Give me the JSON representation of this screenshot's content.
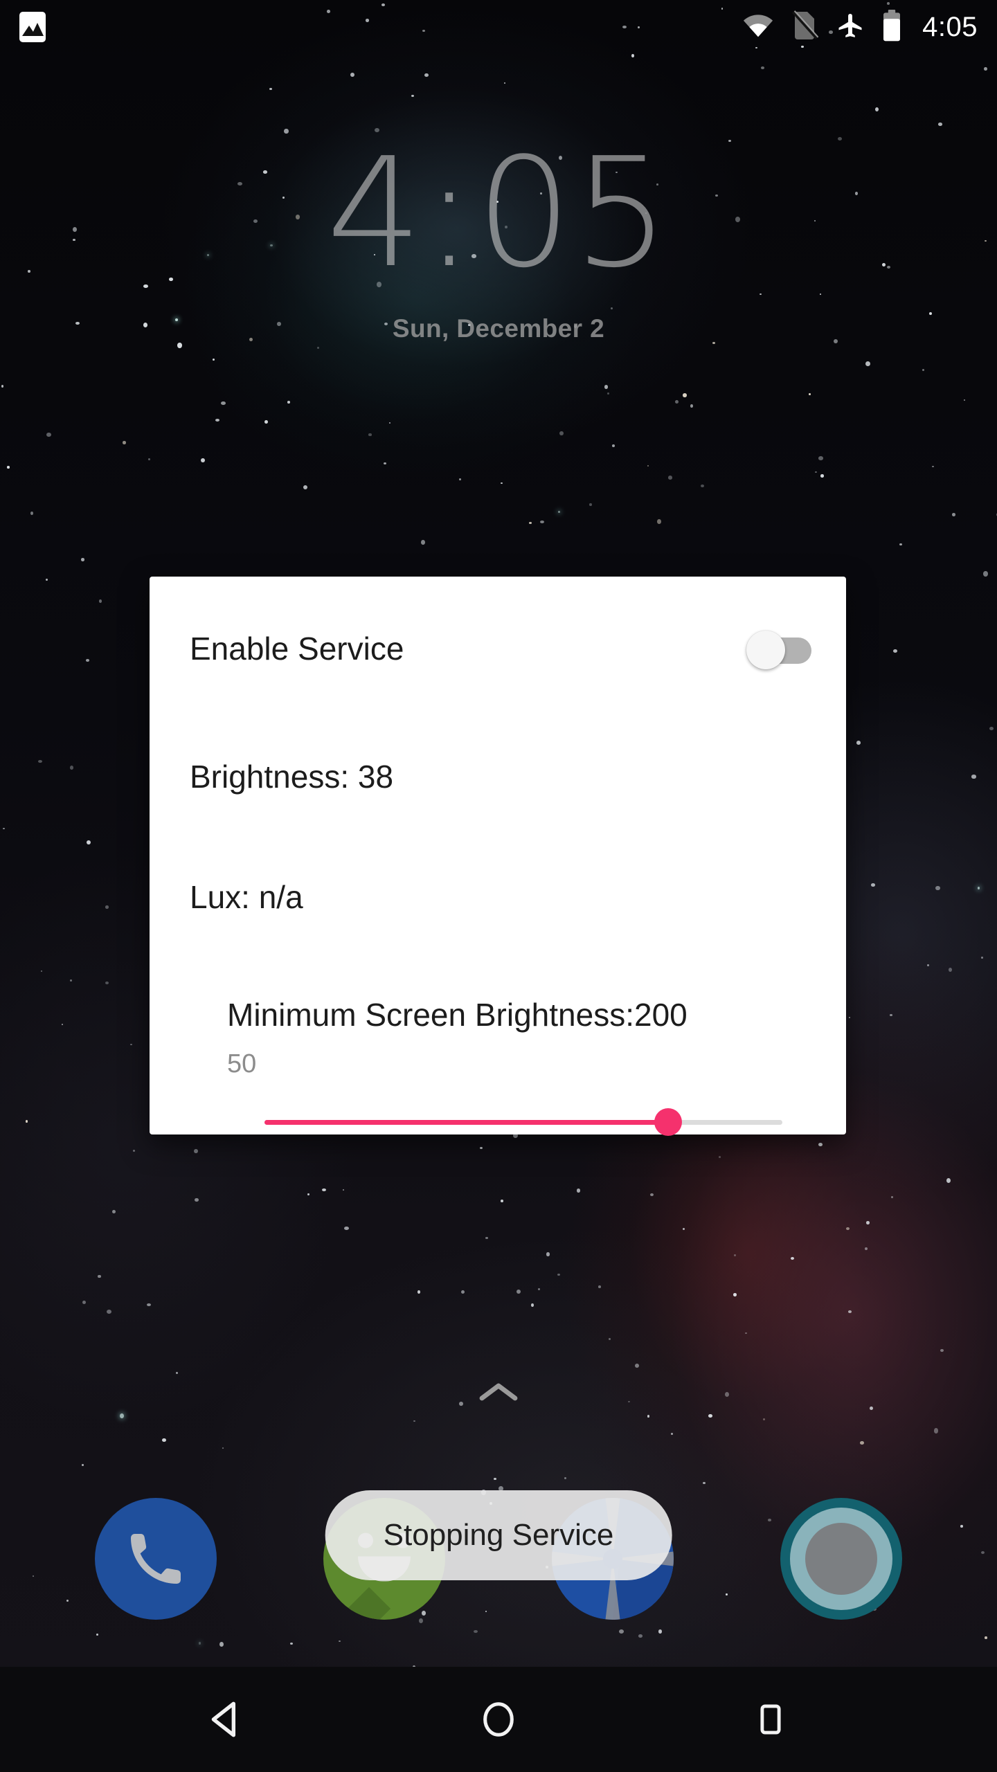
{
  "status_bar": {
    "left_icons": [
      {
        "name": "photo-icon",
        "glyph": "image"
      }
    ],
    "right_icons": [
      {
        "name": "wifi-icon",
        "glyph": "wifi"
      },
      {
        "name": "sim-card-off-icon",
        "glyph": "sim-off"
      },
      {
        "name": "airplane-mode-icon",
        "glyph": "airplane"
      },
      {
        "name": "battery-icon",
        "glyph": "battery"
      }
    ],
    "time": "4:05"
  },
  "lockscreen_widget": {
    "time": "4:05",
    "date": "Sun, December 2"
  },
  "dialog": {
    "enable_service_label": "Enable Service",
    "enable_service_state": "off",
    "brightness_readout": "Brightness: 38",
    "lux_readout": "Lux: n/a",
    "min_brightness_label": "Minimum Screen Brightness:200",
    "min_brightness_value": "50",
    "slider": {
      "percent": 78,
      "accent_color": "#f5316d",
      "track_color": "#dcdcdc"
    }
  },
  "app_drawer": {
    "handle_icon": "chevron-up-icon"
  },
  "dock": {
    "apps": [
      {
        "name": "phone",
        "label": "Phone",
        "color": "#1f4f9c"
      },
      {
        "name": "messages",
        "label": "Messages",
        "color": "#5d8a2e"
      },
      {
        "name": "maps",
        "label": "Maps",
        "color": "#1e4fa3"
      },
      {
        "name": "camera",
        "label": "Camera",
        "color": "#13616e"
      }
    ]
  },
  "toast": {
    "message": "Stopping Service"
  },
  "nav_bar": {
    "buttons": [
      {
        "name": "back-button",
        "icon": "triangle-left-icon"
      },
      {
        "name": "home-button",
        "icon": "circle-icon"
      },
      {
        "name": "recents-button",
        "icon": "square-icon"
      }
    ]
  },
  "colors": {
    "accent_pink": "#f5316d",
    "dialog_bg": "#ffffff",
    "text_primary": "#1c1c1c",
    "text_secondary": "#8c8c8c"
  }
}
